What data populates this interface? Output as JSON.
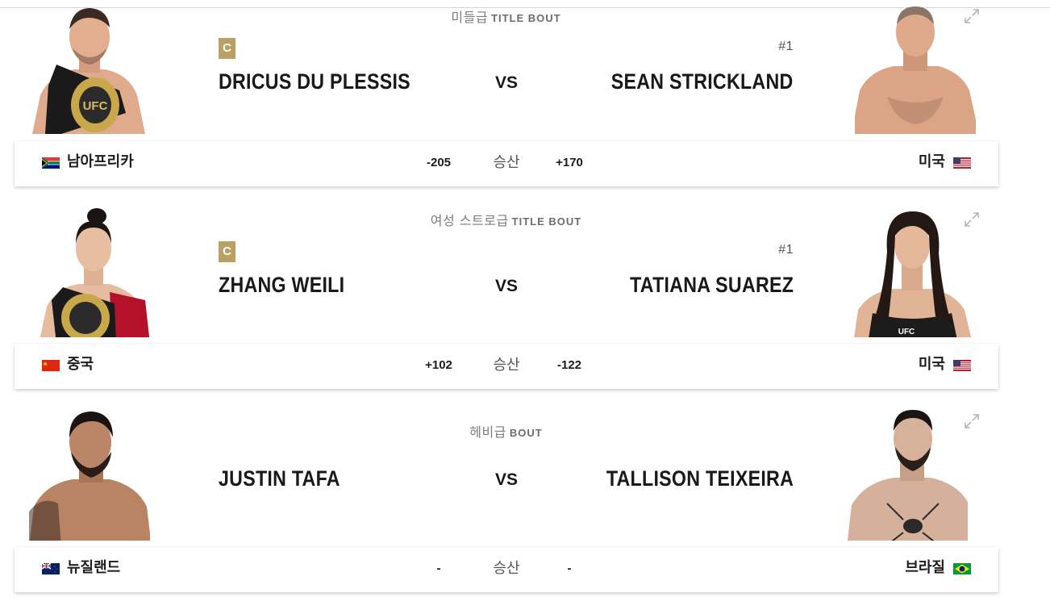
{
  "bouts": [
    {
      "weight_class": "미들급",
      "bout_type": "TITLE BOUT",
      "red": {
        "name": "DRICUS DU PLESSIS",
        "badge": "C",
        "rank": "",
        "country": "남아프리카",
        "flag": "south-africa-flag",
        "odds": "-205"
      },
      "blue": {
        "name": "SEAN STRICKLAND",
        "badge": "",
        "rank": "#1",
        "country": "미국",
        "flag": "usa-flag",
        "odds": "+170"
      },
      "vs": "VS",
      "win_label": "승산"
    },
    {
      "weight_class": "여성 스트로급",
      "bout_type": "TITLE BOUT",
      "red": {
        "name": "ZHANG WEILI",
        "badge": "C",
        "rank": "",
        "country": "중국",
        "flag": "china-flag",
        "odds": "+102"
      },
      "blue": {
        "name": "TATIANA SUAREZ",
        "badge": "",
        "rank": "#1",
        "country": "미국",
        "flag": "usa-flag",
        "odds": "-122"
      },
      "vs": "VS",
      "win_label": "승산"
    },
    {
      "weight_class": "헤비급",
      "bout_type": "BOUT",
      "red": {
        "name": "JUSTIN TAFA",
        "badge": "",
        "rank": "",
        "country": "뉴질랜드",
        "flag": "new-zealand-flag",
        "odds": "-"
      },
      "blue": {
        "name": "TALLISON TEIXEIRA",
        "badge": "",
        "rank": "",
        "country": "브라질",
        "flag": "brazil-flag",
        "odds": "-"
      },
      "vs": "VS",
      "win_label": "승산"
    }
  ],
  "colors": {
    "champion_badge": "#b9a063",
    "text": "#191919",
    "muted": "#7d7d7d"
  }
}
